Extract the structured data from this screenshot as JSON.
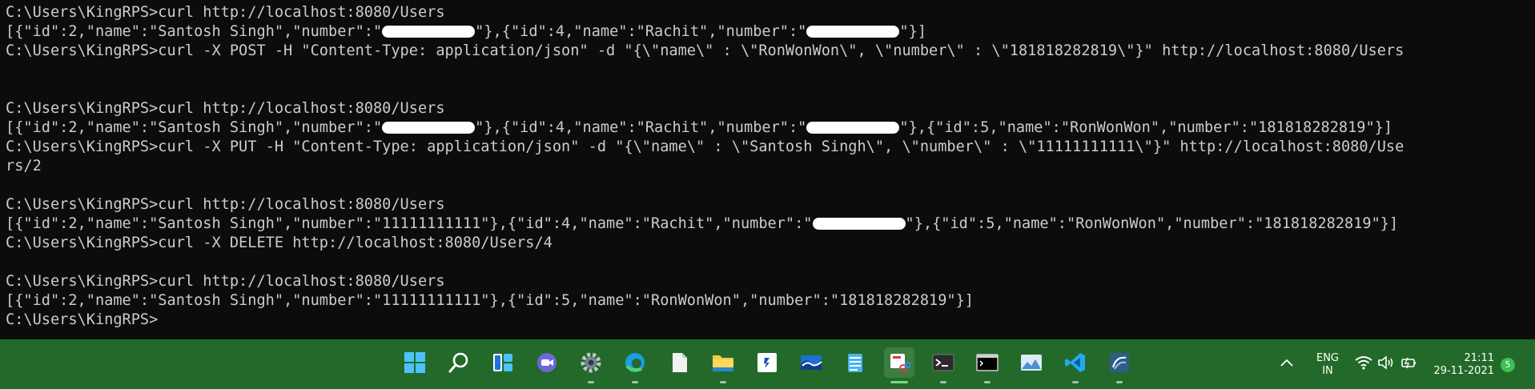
{
  "terminal": {
    "l1": "C:\\Users\\KingRPS>curl http://localhost:8080/Users",
    "l2a": "[{\"id\":2,\"name\":\"Santosh Singh\",\"number\":\"",
    "l2b": "\"},{\"id\":4,\"name\":\"Rachit\",\"number\":\"",
    "l2c": "\"}]",
    "l3": "C:\\Users\\KingRPS>curl -X POST -H \"Content-Type: application/json\" -d \"{\\\"name\\\" : \\\"RonWonWon\\\", \\\"number\\\" : \\\"181818282819\\\"}\" http://localhost:8080/Users",
    "l4": "C:\\Users\\KingRPS>curl http://localhost:8080/Users",
    "l5a": "[{\"id\":2,\"name\":\"Santosh Singh\",\"number\":\"",
    "l5b": "\"},{\"id\":4,\"name\":\"Rachit\",\"number\":\"",
    "l5c": "\"},{\"id\":5,\"name\":\"RonWonWon\",\"number\":\"181818282819\"}]",
    "l6": "C:\\Users\\KingRPS>curl -X PUT -H \"Content-Type: application/json\" -d \"{\\\"name\\\" : \\\"Santosh Singh\\\", \\\"number\\\" : \\\"11111111111\\\"}\" http://localhost:8080/Use",
    "l7": "rs/2",
    "l8": "C:\\Users\\KingRPS>curl http://localhost:8080/Users",
    "l9a": "[{\"id\":2,\"name\":\"Santosh Singh\",\"number\":\"11111111111\"},{\"id\":4,\"name\":\"Rachit\",\"number\":\"",
    "l9b": "\"},{\"id\":5,\"name\":\"RonWonWon\",\"number\":\"181818282819\"}]",
    "l10": "C:\\Users\\KingRPS>curl -X DELETE http://localhost:8080/Users/4",
    "l11": "C:\\Users\\KingRPS>curl http://localhost:8080/Users",
    "l12": "[{\"id\":2,\"name\":\"Santosh Singh\",\"number\":\"11111111111\"},{\"id\":5,\"name\":\"RonWonWon\",\"number\":\"181818282819\"}]",
    "l13": "C:\\Users\\KingRPS>"
  },
  "taskbar": {
    "apps": [
      "start-icon",
      "search-icon",
      "widgets-icon",
      "chat-icon",
      "settings-icon",
      "edge-icon",
      "file-icon",
      "file-explorer-icon",
      "app-icon",
      "mail-icon",
      "notepad-icon",
      "snipping-tool-icon",
      "terminal-icon",
      "cmd-icon",
      "photos-icon",
      "vscode-icon",
      "app-icon-2"
    ],
    "tray": {
      "lang_top": "ENG",
      "lang_bottom": "IN",
      "time": "21:11",
      "date": "29-11-2021",
      "notif_count": "5"
    }
  },
  "colors": {
    "terminal_bg": "#0c0c0c",
    "terminal_text": "#cccccc",
    "taskbar_bg": "#236a2a"
  }
}
